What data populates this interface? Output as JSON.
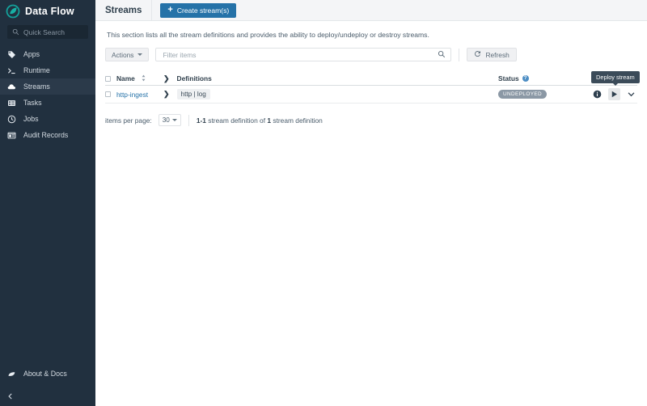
{
  "sidebar": {
    "brand": {
      "title": "Data Flow",
      "logo_icon": "spring-leaf-logo-icon"
    },
    "quick_search": {
      "placeholder": "Quick Search",
      "icon": "search-icon"
    },
    "items": [
      {
        "label": "Apps",
        "icon": "tag-icon",
        "active": false
      },
      {
        "label": "Runtime",
        "icon": "terminal-prompt-icon",
        "active": false
      },
      {
        "label": "Streams",
        "icon": "cloud-icon",
        "active": true
      },
      {
        "label": "Tasks",
        "icon": "task-list-icon",
        "active": false
      },
      {
        "label": "Jobs",
        "icon": "clock-icon",
        "active": false
      },
      {
        "label": "Audit Records",
        "icon": "records-table-icon",
        "active": false
      }
    ],
    "about": {
      "label": "About & Docs",
      "icon": "leaf-icon"
    },
    "collapse": {
      "icon": "chevron-left-icon"
    }
  },
  "topbar": {
    "title": "Streams",
    "create_button": {
      "label": "Create stream(s)",
      "icon": "plus-icon"
    }
  },
  "content": {
    "description": "This section lists all the stream definitions and provides the ability to deploy/undeploy or destroy streams.",
    "toolbar": {
      "actions_label": "Actions",
      "actions_caret_icon": "caret-down-icon",
      "filter_placeholder": "Filter items",
      "filter_value": "",
      "filter_search_icon": "search-icon",
      "refresh_label": "Refresh",
      "refresh_icon": "refresh-icon"
    },
    "table": {
      "columns": {
        "name": "Name",
        "definitions": "Definitions",
        "status": "Status"
      },
      "name_sort_icon": "sort-icon",
      "expand_icon": "chevron-right-icon",
      "status_help_icon": "help-icon",
      "rows": [
        {
          "name": "http-ingest",
          "definition": "http | log",
          "status": "UNDEPLOYED",
          "actions": [
            "info-icon",
            "play-icon",
            "chevron-down-icon"
          ]
        }
      ]
    },
    "tooltip": "Deploy stream",
    "pagination": {
      "items_per_page_label": "items per page:",
      "items_per_page_value": "30",
      "caret_icon": "caret-down-icon",
      "range": "1-1",
      "middle_text": "stream definition of",
      "total": "1",
      "suffix_text": "stream definition"
    }
  },
  "colors": {
    "sidebar_bg": "#21303f",
    "sidebar_active": "#2b3a4a",
    "accent_blue": "#2572a8",
    "badge_gray": "#8b98a5",
    "logo_teal": "#14a09a"
  }
}
